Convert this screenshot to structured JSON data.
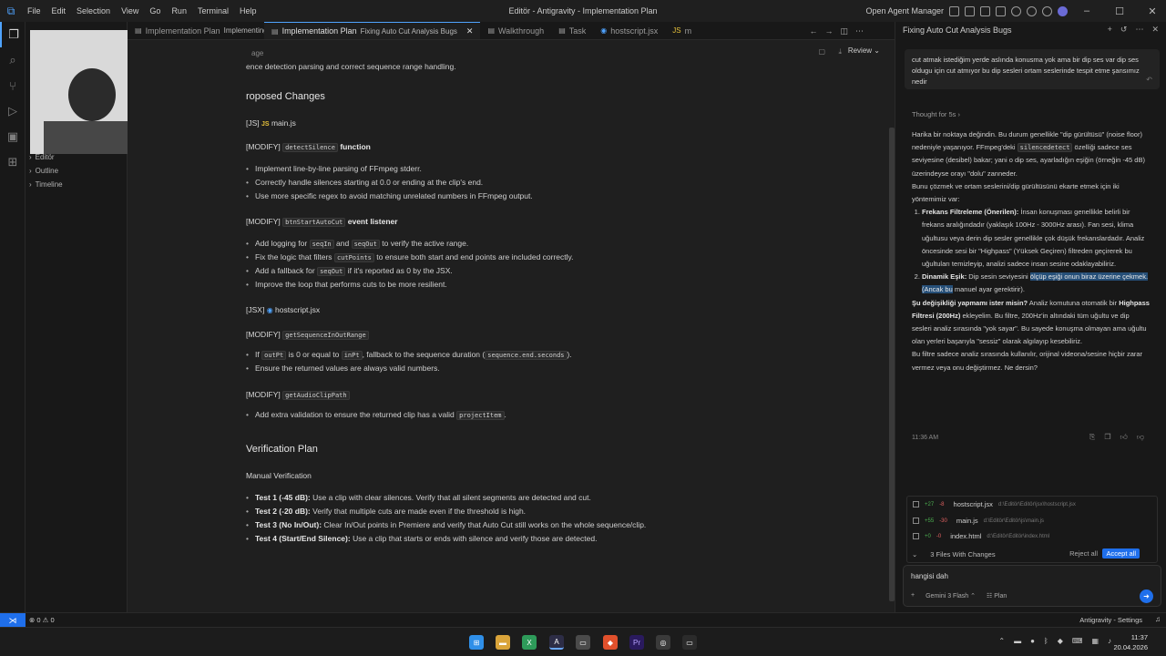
{
  "titlebar": {
    "menu": [
      "File",
      "Edit",
      "Selection",
      "View",
      "Go",
      "Run",
      "Terminal",
      "Help"
    ],
    "window_title": "Editör - Antigravity - Implementation Plan",
    "open_agent_manager": "Open Agent Manager"
  },
  "sidebar": {
    "sections": [
      "Editör",
      "Outline",
      "Timeline"
    ]
  },
  "tabs": [
    {
      "label": "Implementation Plan",
      "sub": "Implementing Auto Cut Functionality",
      "active": false
    },
    {
      "label": "Implementation Plan",
      "sub": "Fixing Auto Cut Analysis Bugs",
      "active": true
    },
    {
      "label": "Walkthrough",
      "sub": "",
      "active": false
    },
    {
      "label": "Task",
      "sub": "",
      "active": false
    },
    {
      "label": "hostscript.jsx",
      "sub": "",
      "active": false
    },
    {
      "label": "m",
      "sub": "",
      "active": false
    }
  ],
  "editor": {
    "review_label": "Review",
    "crumb_tail": "age",
    "intro": "ence detection parsing and correct sequence range handling.",
    "proposed_heading": "roposed Changes",
    "js_file": {
      "tag": "[JS]",
      "name": "main.js"
    },
    "mod1": {
      "tag": "[MODIFY]",
      "code": "detectSilence",
      "suffix": "function"
    },
    "mod1_bullets": [
      "Implement line-by-line parsing of FFmpeg stderr.",
      "Correctly handle silences starting at 0.0 or ending at the clip's end.",
      "Use more specific regex to avoid matching unrelated numbers in FFmpeg output."
    ],
    "mod2": {
      "tag": "[MODIFY]",
      "code": "btnStartAutoCut",
      "suffix": "event listener"
    },
    "mod2_b1": {
      "pre": "Add logging for",
      "c1": "seqIn",
      "mid": "and",
      "c2": "seqOut",
      "post": "to verify the active range."
    },
    "mod2_b2": {
      "pre": "Fix the logic that filters",
      "c1": "cutPoints",
      "post": "to ensure both start and end points are included correctly."
    },
    "mod2_b3": {
      "pre": "Add a fallback for",
      "c1": "seqOut",
      "post": "if it's reported as 0 by the JSX."
    },
    "mod2_b4": "Improve the loop that performs cuts to be more resilient.",
    "jsx_file": {
      "tag": "[JSX]",
      "name": "hostscript.jsx"
    },
    "mod3": {
      "tag": "[MODIFY]",
      "code": "getSequenceInOutRange"
    },
    "mod3_b1": {
      "pre": "If",
      "c1": "outPt",
      "mid": "is 0 or equal to",
      "c2": "inPt",
      "mid2": ", fallback to the sequence duration (",
      "c3": "sequence.end.seconds",
      "post": ")."
    },
    "mod3_b2": "Ensure the returned values are always valid numbers.",
    "mod4": {
      "tag": "[MODIFY]",
      "code": "getAudioClipPath"
    },
    "mod4_b1": {
      "pre": "Add extra validation to ensure the returned clip has a valid",
      "c1": "projectItem",
      "post": "."
    },
    "verification_heading": "Verification Plan",
    "manual_heading": "Manual Verification",
    "tests": [
      {
        "name": "Test 1 (-45 dB):",
        "text": "Use a clip with clear silences. Verify that all silent segments are detected and cut."
      },
      {
        "name": "Test 2 (-20 dB):",
        "text": "Verify that multiple cuts are made even if the threshold is high."
      },
      {
        "name": "Test 3 (No In/Out):",
        "text": "Clear In/Out points in Premiere and verify that Auto Cut still works on the whole sequence/clip."
      },
      {
        "name": "Test 4 (Start/End Silence):",
        "text": "Use a clip that starts or ends with silence and verify those are detected."
      }
    ]
  },
  "agent": {
    "title": "Fixing Auto Cut Analysis Bugs",
    "user_message": "cut atmak istediğim yerde aslında konusma yok ama bir dip ses var dip ses oldugu için cut atmıyor bu dip sesleri ortam seslerinde tespit etme şansımız nedir",
    "thought": "Thought for 5s",
    "p1_pre": "Harika bir noktaya değindin. Bu durum genellikle \"dip gürültüsü\" (noise floor) nedeniyle yaşanıyor. FFmpeg'deki ",
    "p1_code": "silencedetect",
    "p1_post": " özelliği sadece ses seviyesine (desibel) bakar; yani o dip ses, ayarladığın eşiğin (örneğin -45 dB) üzerindeyse orayı \"dolu\" zanneder.",
    "p2": "Bunu çözmek ve ortam seslerini/dip gürültüsünü ekarte etmek için iki yöntemimiz var:",
    "li1_title": "Frekans Filtreleme (Önerilen):",
    "li1_text": " İnsan konuşması genellikle belirli bir frekans aralığındadır (yaklaşık 100Hz - 3000Hz arası). Fan sesi, klima uğultusu veya derin dip sesler genellikle çok düşük frekanslardadır. Analiz öncesinde sesi bir \"Highpass\" (Yüksek Geçiren) filtreden geçirerek bu uğultuları temizleyip, analizi sadece insan sesine odaklayabiliriz.",
    "li2_title": "Dinamik Eşik:",
    "li2_pre": " Dip sesin seviyesini ",
    "li2_hl": "ölçüp eşiği onun biraz üzerine çekmek. (Ancak bu",
    "li2_post": " manuel ayar gerektirir).",
    "p3_b1": "Şu değişikliği yapmamı ister misin?",
    "p3_t1": " Analiz komutuna otomatik bir ",
    "p3_b2": "Highpass Filtresi (200Hz)",
    "p3_t2": " ekleyelim. Bu filtre, 200Hz'in altındaki tüm uğultu ve dip sesleri analiz sırasında \"yok sayar\". Bu sayede konuşma olmayan ama uğultu olan yerleri başarıyla \"sessiz\" olarak algılayıp kesebiliriz.",
    "p4": "Bu filtre sadece analiz sırasında kullanılır, orijinal videona/sesine hiçbir zarar vermez veya onu değiştirmez. Ne dersin?",
    "time": "11:36 AM",
    "files": [
      {
        "add": "+27",
        "del": "-8",
        "name": "hostscript.jsx",
        "path": "d:\\Editör\\Editör\\jsx\\hostscript.jsx"
      },
      {
        "add": "+55",
        "del": "-30",
        "name": "main.js",
        "path": "d:\\Editör\\Editör\\js\\main.js"
      },
      {
        "add": "+0",
        "del": "-0",
        "name": "index.html",
        "path": "d:\\Editör\\Editör\\index.html"
      }
    ],
    "files_changed": "3 Files With Changes",
    "reject_all": "Reject all",
    "accept_all": "Accept all",
    "input_text": "hangisi dah",
    "model": "Gemini 3 Flash",
    "mode": "Plan"
  },
  "status": {
    "problems": "0 ⚠ 0",
    "settings": "Antigravity - Settings"
  },
  "taskbar": {
    "time": "11:37",
    "date": "20.04.2026"
  }
}
